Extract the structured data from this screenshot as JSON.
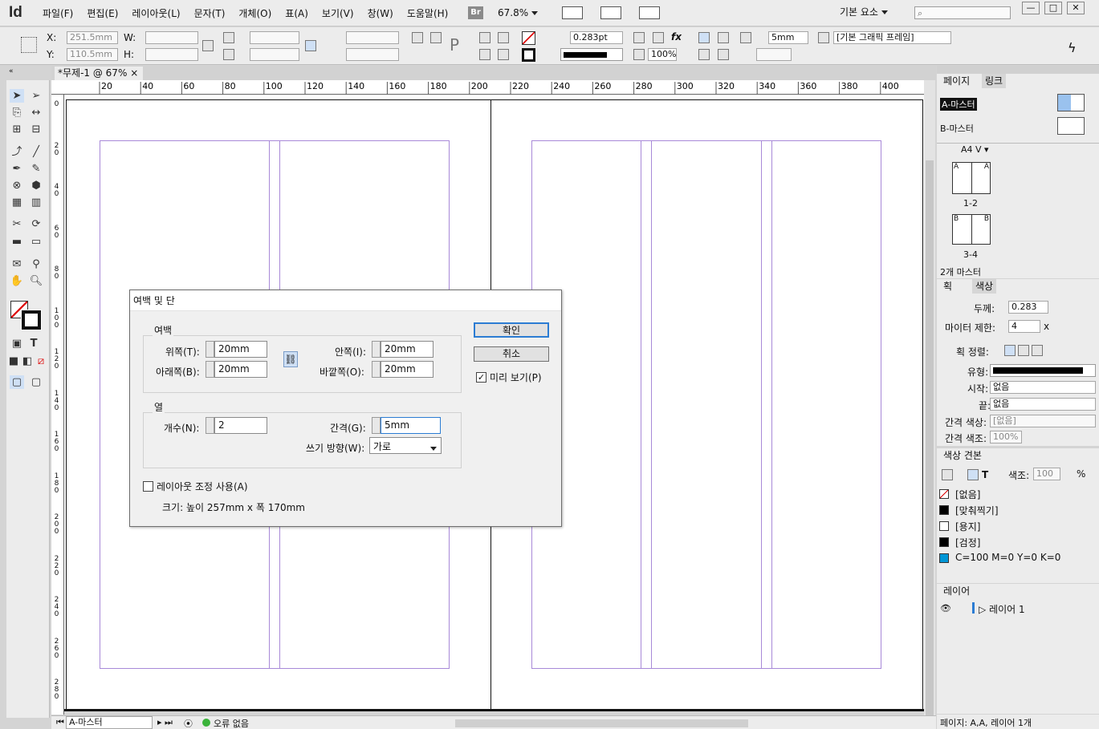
{
  "app": {
    "logo": "Id",
    "menu": [
      "파일(F)",
      "편집(E)",
      "레이아웃(L)",
      "문자(T)",
      "개체(O)",
      "표(A)",
      "보기(V)",
      "창(W)",
      "도움말(H)"
    ],
    "bridge": "Br",
    "zoom": "67.8%",
    "workspace": "기본 요소"
  },
  "control": {
    "x_label": "X:",
    "x_value": "251.5mm",
    "y_label": "Y:",
    "y_value": "110.5mm",
    "w_label": "W:",
    "h_label": "H:",
    "stroke_weight": "0.283pt",
    "opacity": "100%",
    "offset": "5mm",
    "frame_style": "[기본 그래픽 프레임]"
  },
  "document": {
    "tab": "*무제-1 @ 67%",
    "ruler_h": [
      "20",
      "40",
      "60",
      "80",
      "100",
      "120",
      "140",
      "160",
      "180",
      "200",
      "220",
      "240",
      "260",
      "280",
      "300",
      "320",
      "340",
      "360",
      "380",
      "400"
    ],
    "ruler_v": [
      "0",
      "2 0",
      "4 0",
      "6 0",
      "8 0",
      "1 0 0",
      "1 2 0",
      "1 4 0",
      "1 6 0",
      "1 8 0",
      "2 0 0",
      "2 2 0",
      "2 4 0",
      "2 6 0",
      "2 8 0"
    ]
  },
  "status": {
    "page": "A-마스터",
    "errors": "오류 없음"
  },
  "dialog": {
    "title": "여백 및 단",
    "margins_label": "여백",
    "top_label": "위쪽(T):",
    "top": "20mm",
    "bottom_label": "아래쪽(B):",
    "bottom": "20mm",
    "inside_label": "안쪽(I):",
    "inside": "20mm",
    "outside_label": "바깥쪽(O):",
    "outside": "20mm",
    "columns_label": "열",
    "count_label": "개수(N):",
    "count": "2",
    "gutter_label": "간격(G):",
    "gutter": "5mm",
    "direction_label": "쓰기 방향(W):",
    "direction": "가로",
    "layout_adjust": "레이아웃 조정 사용(A)",
    "size_text": "크기: 높이 257mm x 폭 170mm",
    "ok": "확인",
    "cancel": "취소",
    "preview": "미리 보기(P)",
    "preview_checked": true,
    "layout_adjust_checked": false
  },
  "pages_panel": {
    "tabs": [
      "페이지",
      "링크"
    ],
    "masters": [
      "A-마스터",
      "B-마스터"
    ],
    "size": "A4 V",
    "spreads": [
      {
        "pages": "1-2",
        "letters": [
          "A",
          "A"
        ]
      },
      {
        "pages": "3-4",
        "letters": [
          "B",
          "B"
        ]
      }
    ],
    "footer": "2개 마스터"
  },
  "stroke_panel": {
    "tabs": [
      "획",
      "색상"
    ],
    "weight_label": "두께:",
    "weight": "0.283",
    "miter_label": "마이터 제한:",
    "miter": "4",
    "miter_unit": "x",
    "align_label": "획 정렬:",
    "type_label": "유형:",
    "start_label": "시작:",
    "start": "없음",
    "end_label": "끝:",
    "end": "없음",
    "gap_color_label": "간격 색상:",
    "gap_color": "[없음]",
    "gap_tint_label": "간격 색조:",
    "gap_tint": "100%"
  },
  "swatches_panel": {
    "tab": "색상 견본",
    "tint_label": "색조:",
    "tint": "100",
    "tint_unit": "%",
    "items": [
      {
        "name": "[없음]",
        "color": "#ffffff"
      },
      {
        "name": "[맞춰찍기]",
        "color": "#000000"
      },
      {
        "name": "[용지]",
        "color": "#ffffff"
      },
      {
        "name": "[검정]",
        "color": "#000000"
      },
      {
        "name": "C=100 M=0 Y=0 K=0",
        "color": "#0096d6"
      }
    ]
  },
  "layers_panel": {
    "tab": "레이어",
    "items": [
      "레이어 1"
    ]
  },
  "panel_footer": "페이지: A,A, 레이어 1개",
  "colors": {
    "margin_guide": "#a889d8",
    "accent": "#2b7cd3"
  }
}
